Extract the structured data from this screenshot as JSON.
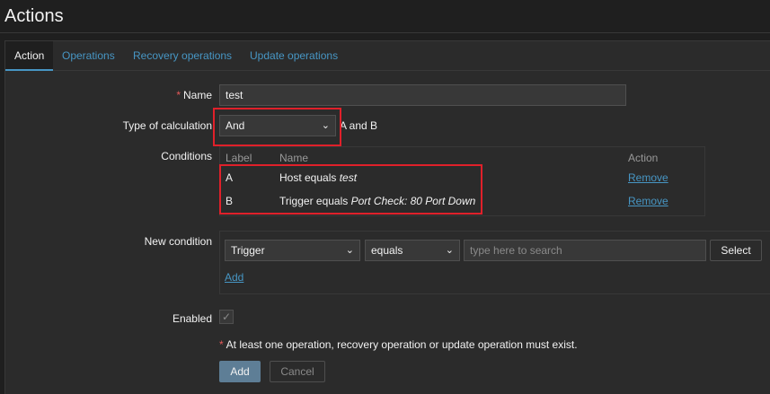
{
  "page": {
    "title": "Actions"
  },
  "tabs": [
    {
      "label": "Action",
      "active": true
    },
    {
      "label": "Operations",
      "active": false
    },
    {
      "label": "Recovery operations",
      "active": false
    },
    {
      "label": "Update operations",
      "active": false
    }
  ],
  "form": {
    "name": {
      "required_mark": "*",
      "label": "Name",
      "value": "test"
    },
    "calc": {
      "label": "Type of calculation",
      "selected": "And",
      "formula": "A and B"
    },
    "conditions": {
      "label": "Conditions",
      "headers": {
        "label": "Label",
        "name": "Name",
        "action": "Action"
      },
      "rows": [
        {
          "label": "A",
          "prefix": "Host equals ",
          "value": "test",
          "action": "Remove"
        },
        {
          "label": "B",
          "prefix": "Trigger equals ",
          "value": "Port Check: 80 Port Down",
          "action": "Remove"
        }
      ]
    },
    "new_condition": {
      "label": "New condition",
      "type_selected": "Trigger",
      "operator_selected": "equals",
      "search_placeholder": "type here to search",
      "select_label": "Select",
      "add_label": "Add"
    },
    "enabled": {
      "label": "Enabled",
      "checked": true
    },
    "warning": {
      "mark": "*",
      "text": "At least one operation, recovery operation or update operation must exist."
    },
    "buttons": {
      "add": "Add",
      "cancel": "Cancel"
    }
  },
  "colors": {
    "background": "#1f1f1f",
    "panel": "#2b2b2b",
    "link": "#4796c4",
    "required": "#e45959",
    "highlight": "#e0202a",
    "primary_button": "#5e7e96"
  }
}
